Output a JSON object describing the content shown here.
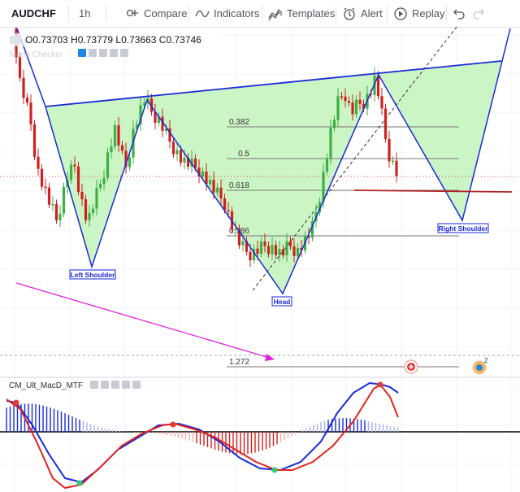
{
  "toolbar": {
    "symbol": "AUDCHF",
    "interval": "1h",
    "compare": "Compare",
    "indicators": "Indicators",
    "templates": "Templates",
    "alert": "Alert",
    "replay": "Replay"
  },
  "main_legend": {
    "ohlc": "O0.73703 H0.73779 L0.73663 C0.73746",
    "indicator_name": "Mario Checker"
  },
  "osc_legend": {
    "name": "CM_Ult_MacD_MTF"
  },
  "badge_count": "2",
  "colors": {
    "bull": "#3cb043",
    "bear": "#d0201f",
    "pattern_fill": "#ccf5c6",
    "pattern_line": "#1a2ad8",
    "target_line": "#b22222",
    "arrow": "#e020e0",
    "macd_line": "#1a2ad8",
    "signal_line": "#e3241d"
  },
  "annotations": {
    "left_shoulder": "Left Shoulder",
    "head": "Head",
    "right_shoulder": "Right Shoulder"
  },
  "fib_levels": [
    {
      "label": "0.382"
    },
    {
      "label": "0.5"
    },
    {
      "label": "0.618"
    },
    {
      "label": "0.786"
    },
    {
      "label": "1.272"
    }
  ],
  "chart_data": [
    {
      "type": "candlestick",
      "title": "AUDCHF",
      "interval": "1h",
      "ohlc_last": {
        "open": 0.73703,
        "high": 0.73779,
        "low": 0.73663,
        "close": 0.73746
      },
      "pattern": "inverse head and shoulders",
      "grid": true
    },
    {
      "type": "bar",
      "title": "CM_Ult_MacD_MTF",
      "grid": true
    }
  ]
}
